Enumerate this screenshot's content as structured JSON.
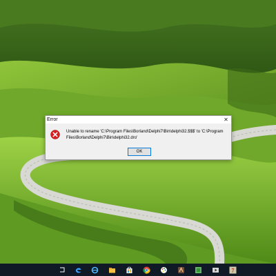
{
  "dialog": {
    "title": "Error",
    "close_glyph": "✕",
    "message": "Unable to rename 'C:\\Program Files\\Borland\\Delphi7\\Bin\\delphi32.$$$' to 'C:\\Program Files\\Borland\\Delphi7\\Bin\\delphi32.dro'",
    "ok_label": "OK",
    "icon": "error-icon"
  },
  "taskbar": {
    "background": "#0f1a26",
    "items": [
      {
        "name": "task-view-icon"
      },
      {
        "name": "edge-icon"
      },
      {
        "name": "internet-explorer-icon"
      },
      {
        "name": "file-explorer-icon"
      },
      {
        "name": "store-icon"
      },
      {
        "name": "chrome-icon"
      },
      {
        "name": "paint-icon"
      },
      {
        "name": "app-icon"
      },
      {
        "name": "green-app-icon"
      },
      {
        "name": "media-icon"
      },
      {
        "name": "delphi-icon"
      }
    ]
  },
  "colors": {
    "accent": "#0078d7",
    "error_red": "#d81e1e"
  }
}
